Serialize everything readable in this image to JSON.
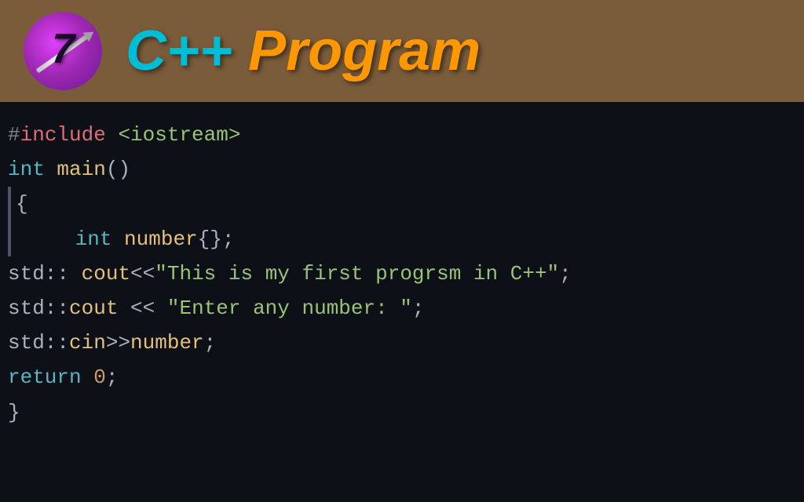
{
  "header": {
    "logo_number": "7",
    "cpp_label": "C++",
    "program_label": "Program"
  },
  "code": {
    "lines": [
      {
        "id": "line1",
        "text": "#include <iostream>"
      },
      {
        "id": "line2",
        "text": "int main()"
      },
      {
        "id": "line3",
        "text": "{"
      },
      {
        "id": "line4",
        "text": "    int number{};"
      },
      {
        "id": "line5",
        "text": "std:: cout<<\"This is my first progrsm in C++\";"
      },
      {
        "id": "line6",
        "text": "std::cout << \"Enter any number: \";"
      },
      {
        "id": "line7",
        "text": "std::cin>>number;"
      },
      {
        "id": "line8",
        "text": "return 0;"
      },
      {
        "id": "line9",
        "text": "}"
      }
    ]
  }
}
